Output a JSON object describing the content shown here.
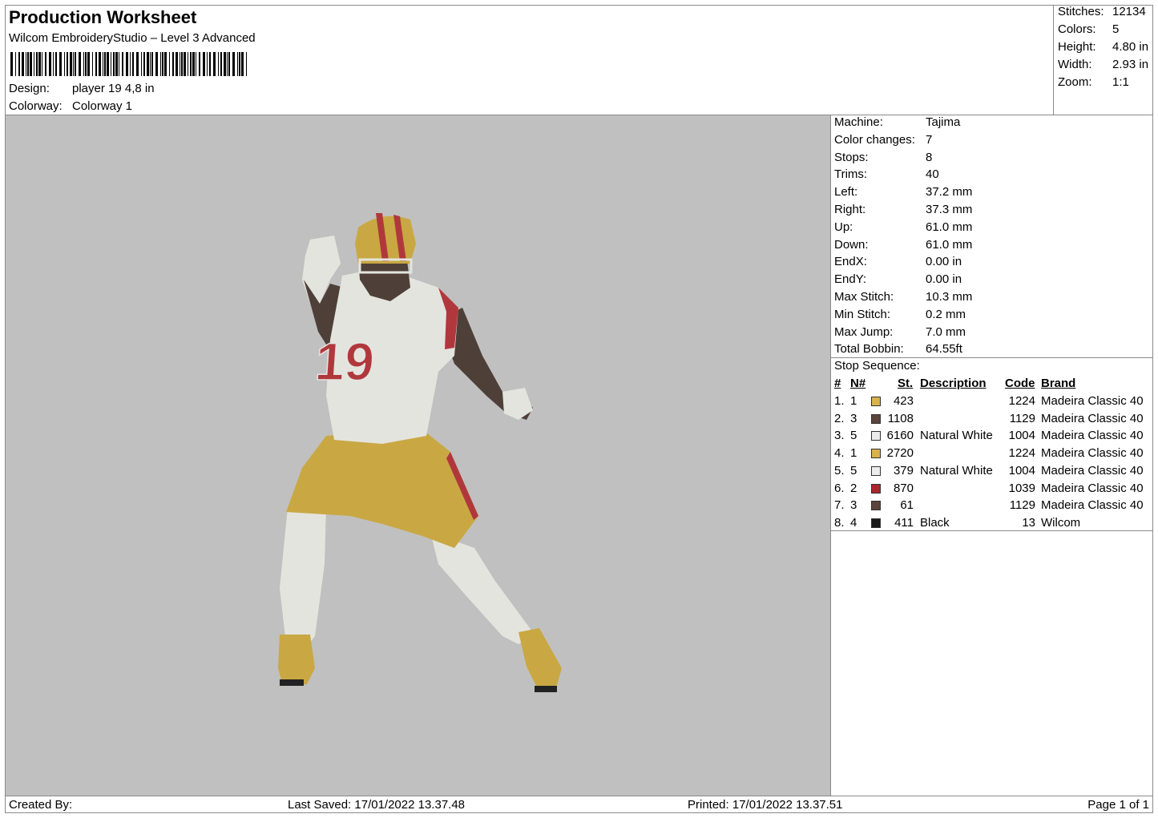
{
  "header": {
    "title": "Production Worksheet",
    "subtitle": "Wilcom EmbroideryStudio – Level 3 Advanced",
    "design_label": "Design:",
    "design_value": "player 19 4,8 in",
    "colorway_label": "Colorway:",
    "colorway_value": "Colorway 1"
  },
  "stats": {
    "stitches_label": "Stitches:",
    "stitches": "12134",
    "colors_label": "Colors:",
    "colors": "5",
    "height_label": "Height:",
    "height": "4.80 in",
    "width_label": "Width:",
    "width": "2.93 in",
    "zoom_label": "Zoom:",
    "zoom": "1:1"
  },
  "machine": {
    "rows": [
      {
        "label": "Machine:",
        "value": "Tajima"
      },
      {
        "label": "Color changes:",
        "value": "7"
      },
      {
        "label": "Stops:",
        "value": "8"
      },
      {
        "label": "Trims:",
        "value": "40"
      },
      {
        "label": "Left:",
        "value": "37.2 mm"
      },
      {
        "label": "Right:",
        "value": "37.3 mm"
      },
      {
        "label": "Up:",
        "value": "61.0 mm"
      },
      {
        "label": "Down:",
        "value": "61.0 mm"
      },
      {
        "label": "EndX:",
        "value": "0.00 in"
      },
      {
        "label": "EndY:",
        "value": "0.00 in"
      },
      {
        "label": "Max Stitch:",
        "value": "10.3 mm"
      },
      {
        "label": "Min Stitch:",
        "value": "0.2 mm"
      },
      {
        "label": "Max Jump:",
        "value": "7.0 mm"
      },
      {
        "label": "Total Bobbin:",
        "value": "64.55ft"
      }
    ]
  },
  "stop_sequence": {
    "title": "Stop Sequence:",
    "headers": {
      "num": "#",
      "n": "N#",
      "st": "St.",
      "desc": "Description",
      "code": "Code",
      "brand": "Brand"
    },
    "rows": [
      {
        "num": "1.",
        "n": "1",
        "color": "#d8b24a",
        "st": "423",
        "desc": "",
        "code": "1224",
        "brand": "Madeira Classic 40"
      },
      {
        "num": "2.",
        "n": "3",
        "color": "#5a453c",
        "st": "1108",
        "desc": "",
        "code": "1129",
        "brand": "Madeira Classic 40"
      },
      {
        "num": "3.",
        "n": "5",
        "color": "#ececec",
        "st": "6160",
        "desc": "Natural White",
        "code": "1004",
        "brand": "Madeira Classic 40"
      },
      {
        "num": "4.",
        "n": "1",
        "color": "#d8b24a",
        "st": "2720",
        "desc": "",
        "code": "1224",
        "brand": "Madeira Classic 40"
      },
      {
        "num": "5.",
        "n": "5",
        "color": "#ececec",
        "st": "379",
        "desc": "Natural White",
        "code": "1004",
        "brand": "Madeira Classic 40"
      },
      {
        "num": "6.",
        "n": "2",
        "color": "#a8282d",
        "st": "870",
        "desc": "",
        "code": "1039",
        "brand": "Madeira Classic 40"
      },
      {
        "num": "7.",
        "n": "3",
        "color": "#5a453c",
        "st": "61",
        "desc": "",
        "code": "1129",
        "brand": "Madeira Classic 40"
      },
      {
        "num": "8.",
        "n": "4",
        "color": "#1a1a1a",
        "st": "411",
        "desc": "Black",
        "code": "13",
        "brand": "Wilcom"
      }
    ]
  },
  "footer": {
    "created_by": "Created By:",
    "last_saved": "Last Saved: 17/01/2022 13.37.48",
    "printed": "Printed: 17/01/2022 13.37.51",
    "page": "Page 1 of 1"
  },
  "design_preview": {
    "jersey_number": "19",
    "palette": {
      "white": "#e4e4df",
      "gold": "#c9a843",
      "red": "#b0383c",
      "skin": "#4e3f38",
      "black": "#222"
    }
  }
}
